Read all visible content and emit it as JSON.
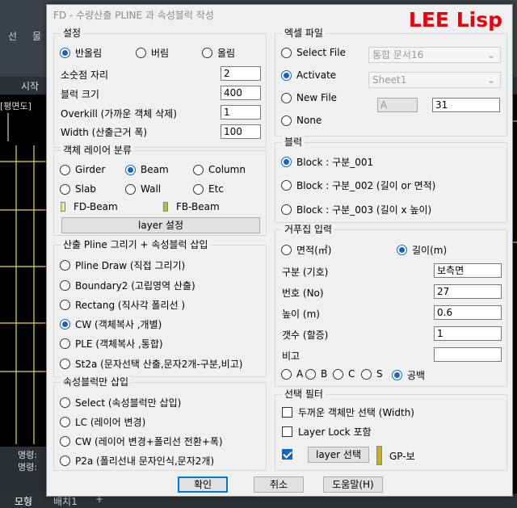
{
  "background": {
    "toolbar_labels": [
      "선",
      "물"
    ],
    "tab_label": "시작",
    "drawing_label": "[평면도]",
    "command_lines": [
      "명령:",
      "명령:"
    ],
    "bottom_tabs": [
      "모형",
      "배치1"
    ],
    "plus": "+"
  },
  "dialog": {
    "title": "FD - 수량산출 PLINE 과  속성블럭 작성",
    "brand": "LEE Lisp"
  },
  "settings": {
    "legend": "설정",
    "rounding": [
      {
        "label": "반올림",
        "on": true
      },
      {
        "label": "버림",
        "on": false
      },
      {
        "label": "올림",
        "on": false
      }
    ],
    "fields": [
      {
        "label": "소숫점 자리",
        "value": "2"
      },
      {
        "label": "블럭 크기",
        "value": "400"
      },
      {
        "label": "Overkill (가까운 객체 삭제)",
        "value": "1"
      },
      {
        "label": "Width (산출근거 폭)",
        "value": "100"
      }
    ]
  },
  "layers": {
    "legend": "객체 레이어 분류",
    "row1": [
      {
        "label": "Girder",
        "on": false
      },
      {
        "label": "Beam",
        "on": true
      },
      {
        "label": "Column",
        "on": false
      }
    ],
    "row2": [
      {
        "label": "Slab",
        "on": false
      },
      {
        "label": "Wall",
        "on": false
      },
      {
        "label": "Etc",
        "on": false
      }
    ],
    "swatches": [
      {
        "label": "FD-Beam",
        "color": "#d9f08c"
      },
      {
        "label": "FB-Beam",
        "color": "#a3c23a"
      }
    ],
    "button": "layer 설정"
  },
  "pline": {
    "legend": "산출 Pline 그리기 + 속성블럭 삽입",
    "items": [
      {
        "label": "Pline Draw (직접 그리기)",
        "on": false
      },
      {
        "label": "Boundary2 (고립영역 산출)",
        "on": false
      },
      {
        "label": "Rectang (직사각 폴리선 )",
        "on": false
      },
      {
        "label": "CW  (객체복사  ,개별)",
        "on": true
      },
      {
        "label": "PLE  (객체복사  ,통합)",
        "on": false
      },
      {
        "label": "St2a (문자선택 산출,문자2개-구분,비고)",
        "on": false
      }
    ]
  },
  "attr": {
    "legend": "속성블럭만 삽입",
    "items": [
      {
        "label": "Select (속성블럭만 삽입)",
        "on": false
      },
      {
        "label": "LC (레이어 변경)",
        "on": false
      },
      {
        "label": "CW (레이어 변경+폴리선 전환+폭)",
        "on": false
      },
      {
        "label": "P2a (폴리선내 문자인식,문자2개)",
        "on": false
      }
    ]
  },
  "excel": {
    "legend": "엑셀 파일",
    "select_file": "Select File",
    "activate": "Activate",
    "new_file": "New File",
    "none": "None",
    "dropdown1": "통합 문서16",
    "dropdown2": "Sheet1",
    "col": "A",
    "row": "31"
  },
  "block": {
    "legend": "블럭",
    "items": [
      {
        "label": "Block : 구분_001",
        "on": true
      },
      {
        "label": "Block : 구분_002 (길이 or 면적)",
        "on": false
      },
      {
        "label": "Block : 구분_003 (길이 x 높이)",
        "on": false
      }
    ]
  },
  "input": {
    "legend": "거푸집 입력",
    "area": "면적(㎡)",
    "length": "길이(m)",
    "fields": [
      {
        "label": "구분 (기호)",
        "value": "보측면"
      },
      {
        "label": "번호 (No)",
        "value": "27"
      },
      {
        "label": "높이 (m)",
        "value": "0.6"
      },
      {
        "label": "갯수 (할증)",
        "value": "1"
      },
      {
        "label": "비고",
        "value": ""
      }
    ],
    "suffix": [
      {
        "label": "A",
        "on": false
      },
      {
        "label": "B",
        "on": false
      },
      {
        "label": "C",
        "on": false
      },
      {
        "label": "S",
        "on": false
      },
      {
        "label": "공백",
        "on": true
      }
    ]
  },
  "filter": {
    "legend": "선택 필터",
    "thick": "두꺼운 객체만 선택 (Width)",
    "lock": "Layer Lock 포함",
    "layer_btn": "layer 선택",
    "layer_name": "GP-보",
    "layer_color": "#c8b400"
  },
  "buttons": {
    "ok": "확인",
    "cancel": "취소",
    "help": "도움말(H)"
  }
}
